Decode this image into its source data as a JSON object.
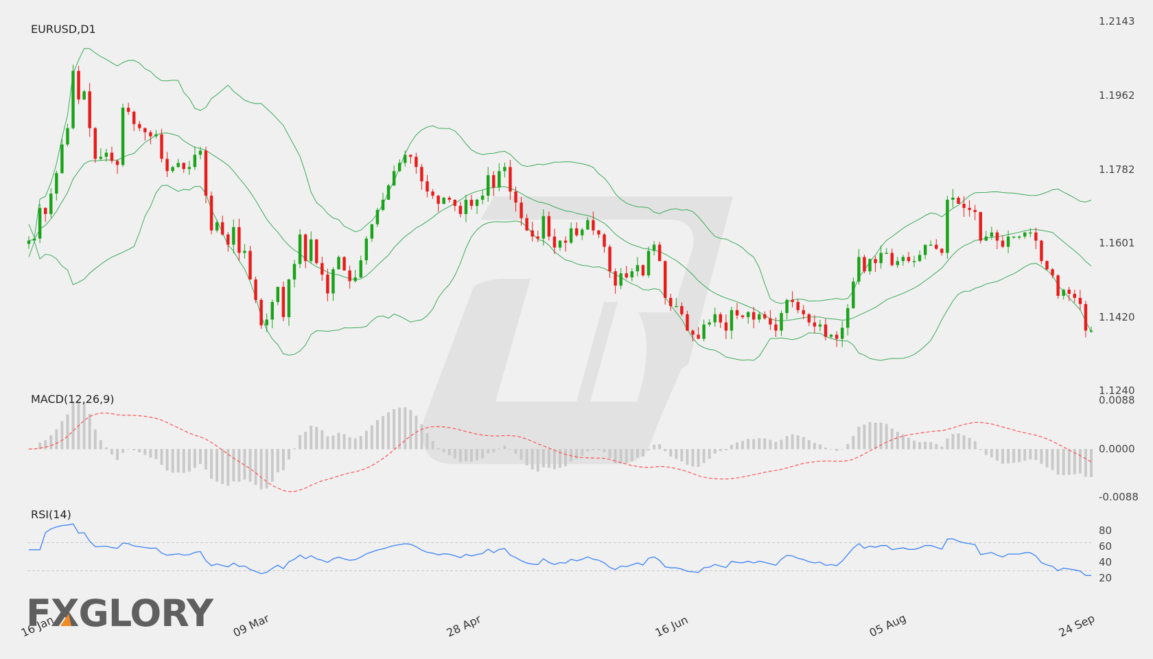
{
  "symbol_label": "EURUSD,D1",
  "brand": {
    "logo_text": "FXGLORY",
    "accent": "#f08a24",
    "text_color": "#5f5f5f"
  },
  "colors": {
    "background": "#f0f0f0",
    "bull": "#1aa21a",
    "bear": "#e81b1b",
    "bollinger": "#3caa5a",
    "macd_signal": "#ff5050",
    "macd_hist": "#c9c9c9",
    "rsi": "#3b82f6",
    "rsi_guides": "#c8c8c8"
  },
  "chart_data": [
    {
      "type": "candlestick",
      "title": "EURUSD,D1",
      "ylim": [
        1.124,
        1.2143
      ],
      "y_ticks": [
        "1.2143",
        "1.1962",
        "1.1782",
        "1.1601",
        "1.1420",
        "1.1240"
      ],
      "x_tick_labels": [
        "16 Jan",
        "09 Mar",
        "28 Apr",
        "16 Jun",
        "05 Aug",
        "24 Sep"
      ],
      "x_tick_index": [
        0,
        37,
        74,
        110,
        147,
        184
      ],
      "overlays": [
        "Bollinger Bands (upper, middle, lower)"
      ],
      "close": [
        1.1605,
        1.161,
        1.1685,
        1.167,
        1.172,
        1.177,
        1.184,
        1.188,
        1.202,
        1.195,
        1.197,
        1.188,
        1.1805,
        1.181,
        1.182,
        1.18,
        1.179,
        1.193,
        1.192,
        1.189,
        1.188,
        1.187,
        1.186,
        1.1865,
        1.1805,
        1.1775,
        1.1785,
        1.1795,
        1.178,
        1.1785,
        1.1815,
        1.1825,
        1.1715,
        1.163,
        1.165,
        1.162,
        1.1595,
        1.1638,
        1.1575,
        1.158,
        1.151,
        1.146,
        1.1398,
        1.1412,
        1.1455,
        1.1492,
        1.1418,
        1.151,
        1.1548,
        1.162,
        1.1555,
        1.1608,
        1.155,
        1.1522,
        1.1476,
        1.1535,
        1.1565,
        1.1532,
        1.1506,
        1.1515,
        1.1557,
        1.161,
        1.1645,
        1.168,
        1.1705,
        1.174,
        1.1775,
        1.1795,
        1.1815,
        1.181,
        1.1785,
        1.175,
        1.1725,
        1.1715,
        1.1695,
        1.171,
        1.1705,
        1.169,
        1.167,
        1.1705,
        1.169,
        1.1705,
        1.1715,
        1.1765,
        1.1735,
        1.1775,
        1.1785,
        1.1725,
        1.1698,
        1.166,
        1.163,
        1.1615,
        1.161,
        1.1665,
        1.1615,
        1.1588,
        1.1605,
        1.16,
        1.1635,
        1.1618,
        1.1632,
        1.1655,
        1.163,
        1.162,
        1.159,
        1.153,
        1.1495,
        1.1525,
        1.1515,
        1.153,
        1.1545,
        1.152,
        1.158,
        1.1595,
        1.1555,
        1.1465,
        1.1445,
        1.1445,
        1.1425,
        1.1385,
        1.1375,
        1.1365,
        1.14,
        1.1405,
        1.1425,
        1.1405,
        1.1385,
        1.1435,
        1.1422,
        1.1418,
        1.143,
        1.1412,
        1.1425,
        1.1415,
        1.14,
        1.1385,
        1.1428,
        1.146,
        1.1455,
        1.1435,
        1.1425,
        1.1405,
        1.1395,
        1.14,
        1.137,
        1.1375,
        1.1365,
        1.1392,
        1.144,
        1.1505,
        1.1565,
        1.153,
        1.156,
        1.155,
        1.1575,
        1.1575,
        1.1545,
        1.1555,
        1.1565,
        1.1555,
        1.1555,
        1.157,
        1.1595,
        1.1595,
        1.1585,
        1.1575,
        1.1705,
        1.171,
        1.1695,
        1.1685,
        1.168,
        1.1675,
        1.1605,
        1.1615,
        1.1625,
        1.1605,
        1.159,
        1.1615,
        1.1615,
        1.1615,
        1.1625,
        1.1625,
        1.1605,
        1.1555,
        1.1535,
        1.152,
        1.147,
        1.1485,
        1.1475,
        1.1465,
        1.145,
        1.1385,
        1.1385
      ]
    },
    {
      "type": "bar+line",
      "title": "MACD(12,26,9)",
      "ylim": [
        -0.0088,
        0.0088
      ],
      "y_ticks": [
        "0.0088",
        "0.0000",
        "-0.0088"
      ],
      "series": [
        {
          "values_ref": "macd histogram + signal (derived from EURUSD close)"
        }
      ]
    },
    {
      "type": "line",
      "title": "RSI(14)",
      "ylim": [
        10,
        90
      ],
      "y_ticks": [
        "80",
        "60",
        "40",
        "20"
      ],
      "levels": [
        70,
        30
      ],
      "series": [
        {
          "values_ref": "rsi(14) of EURUSD close"
        }
      ]
    }
  ]
}
